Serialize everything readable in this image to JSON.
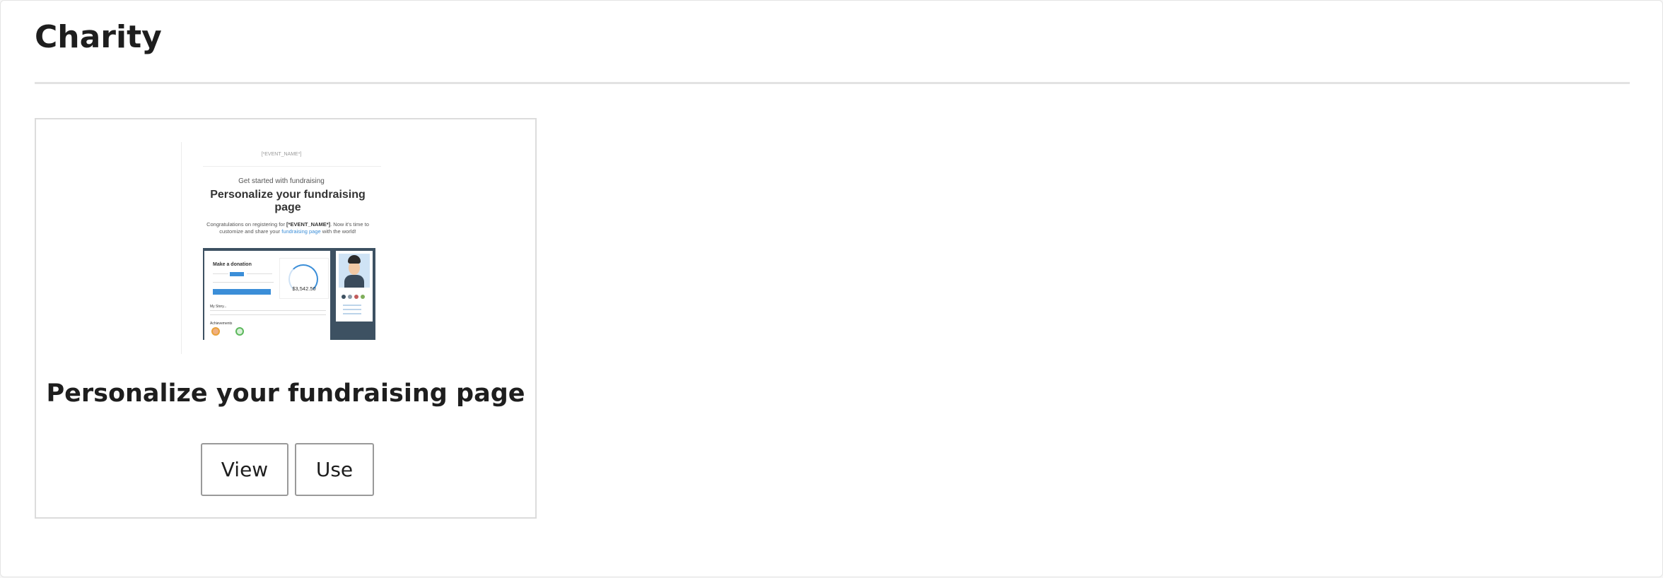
{
  "section": {
    "title": "Charity"
  },
  "templates": [
    {
      "title": "Personalize your fundraising page",
      "actions": {
        "view_label": "View",
        "use_label": "Use"
      },
      "preview": {
        "event_tag": "[*EVENT_NAME*]",
        "eyebrow": "Get started with fundraising",
        "heading": "Personalize your fundraising page",
        "body_prefix": "Congratulations on registering for ",
        "body_event": "[*EVENT_NAME*]",
        "body_mid": ". Now it's time to customize and share your ",
        "body_link": "fundraising page",
        "body_suffix": " with the world!",
        "donation_label": "Make a donation",
        "amount": "$3,542.50",
        "story_label": "My Story...",
        "achievements_label": "Achievements"
      }
    }
  ],
  "colors": {
    "accent": "#3b8ed8",
    "dark_panel": "#3d5162",
    "border": "#dcdcdc"
  }
}
